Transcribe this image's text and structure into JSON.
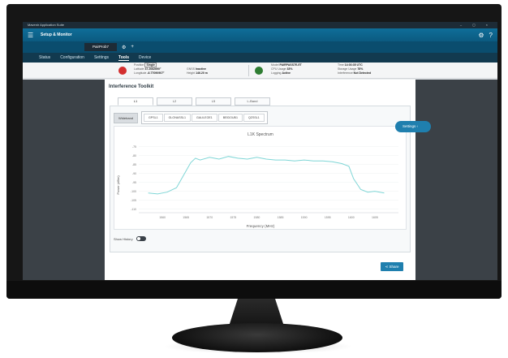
{
  "window": {
    "title": "Mavenir Application Suite",
    "controls": "– ◻ ×"
  },
  "appbar": {
    "menu_icon": "menu-icon",
    "title": "Setup & Monitor",
    "settings_icon": "gear-icon",
    "help_icon": "help-icon"
  },
  "tabs": {
    "probe_tab": "PairProb7",
    "add_icon": "plus-icon"
  },
  "nav": {
    "items": [
      "Status",
      "Configuration",
      "Settings",
      "Tools",
      "Device"
    ],
    "active": "Tools"
  },
  "status": {
    "colors": {
      "red": "#d32f2f",
      "green": "#2e7d32"
    },
    "pos_label": "Position",
    "pos_value": "Single",
    "lat_label": "Latitude",
    "lat_value": "37.2082690°",
    "lon_label": "Longitude",
    "lon_value": "-6.77090907°",
    "gnss_label": "GNSS",
    "gnss_value": "Inactive",
    "height_label": "Height",
    "height_value": "146.20 m",
    "model_label": "Model",
    "model_value": "PAIRPASS7E-ET",
    "cpu_label": "CPU Usage",
    "cpu_value": "33%",
    "logging_label": "Logging",
    "logging_value": "Active",
    "time_label": "Time",
    "time_value": "14:03:35 UTC",
    "storage_label": "Storage Usage",
    "storage_value": "78%",
    "interference_label": "Interference",
    "interference_value": "Not Detected"
  },
  "toolkit": {
    "title": "Interference Toolkit",
    "settings_label": "Settings",
    "band_tabs": [
      "L1",
      "L2",
      "L5",
      "L-Band"
    ],
    "wideband_label": "Wideband",
    "channels": [
      "GPSL1",
      "GLONASSL1",
      "GALILEOE1",
      "BEIDOUB1",
      "QZSSL1"
    ],
    "show_history_label": "Show History",
    "share_label": "Share"
  },
  "chart_data": {
    "type": "line",
    "title": "L1K Spectrum",
    "xlabel": "Frequency (MHz)",
    "ylabel": "Power (dBm)",
    "x_ticks": [
      "1560",
      "1565",
      "1570",
      "1575",
      "1580",
      "1585",
      "1590",
      "1595",
      "1600",
      "1605"
    ],
    "y_ticks": [
      "-75",
      "-80",
      "-85",
      "-90",
      "-95",
      "-100",
      "-105",
      "-110"
    ],
    "xlim": [
      1555,
      1610
    ],
    "ylim": [
      -112,
      -72
    ],
    "series": [
      {
        "color": "#7fd6d6",
        "x": [
          1557,
          1559,
          1561,
          1563,
          1564.5,
          1566,
          1567,
          1568,
          1570,
          1572,
          1574,
          1576,
          1578,
          1580,
          1582,
          1584,
          1586,
          1588,
          1590,
          1592,
          1594,
          1596,
          1598,
          1599.5,
          1600.5,
          1602,
          1603.5,
          1605,
          1607
        ],
        "y": [
          -101,
          -101.5,
          -100.5,
          -98,
          -91,
          -84,
          -81.5,
          -82.5,
          -81,
          -82,
          -80.5,
          -81.5,
          -82,
          -81,
          -82,
          -82.5,
          -82.5,
          -83,
          -82.5,
          -83,
          -83,
          -83.5,
          -84.5,
          -86,
          -93,
          -99,
          -100.5,
          -100,
          -101
        ]
      }
    ]
  }
}
